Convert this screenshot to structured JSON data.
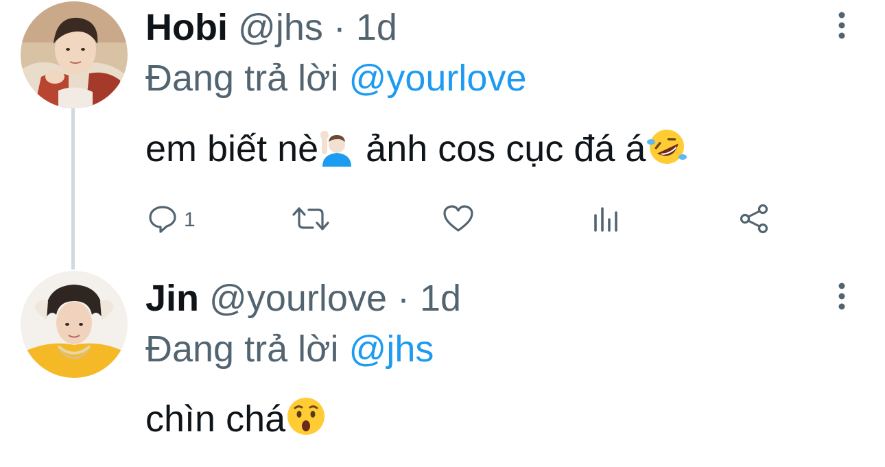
{
  "tweets": [
    {
      "display_name": "Hobi",
      "handle": "@jhs",
      "separator": "·",
      "time": "1d",
      "reply_prefix": "Đang trả lời",
      "reply_to": "@yourlove",
      "text_part1": "em biết nè",
      "text_part2": " ảnh cos cục đá á",
      "emojis": [
        "person-raising-hand-emoji",
        "rolling-on-floor-laughing-emoji"
      ],
      "actions": {
        "reply_count": "1"
      }
    },
    {
      "display_name": "Jin",
      "handle": "@yourlove",
      "separator": "·",
      "time": "1d",
      "reply_prefix": "Đang trả lời",
      "reply_to": "@jhs",
      "text_part1": "chìn chá",
      "emojis": [
        "hushed-face-emoji"
      ]
    }
  ],
  "colors": {
    "text_primary": "#0f1419",
    "text_secondary": "#536471",
    "mention": "#1d9bf0",
    "thread_line": "#cfd9de"
  },
  "icons": [
    "more-vertical-icon",
    "reply-icon",
    "retweet-icon",
    "like-icon",
    "views-icon",
    "share-icon"
  ]
}
